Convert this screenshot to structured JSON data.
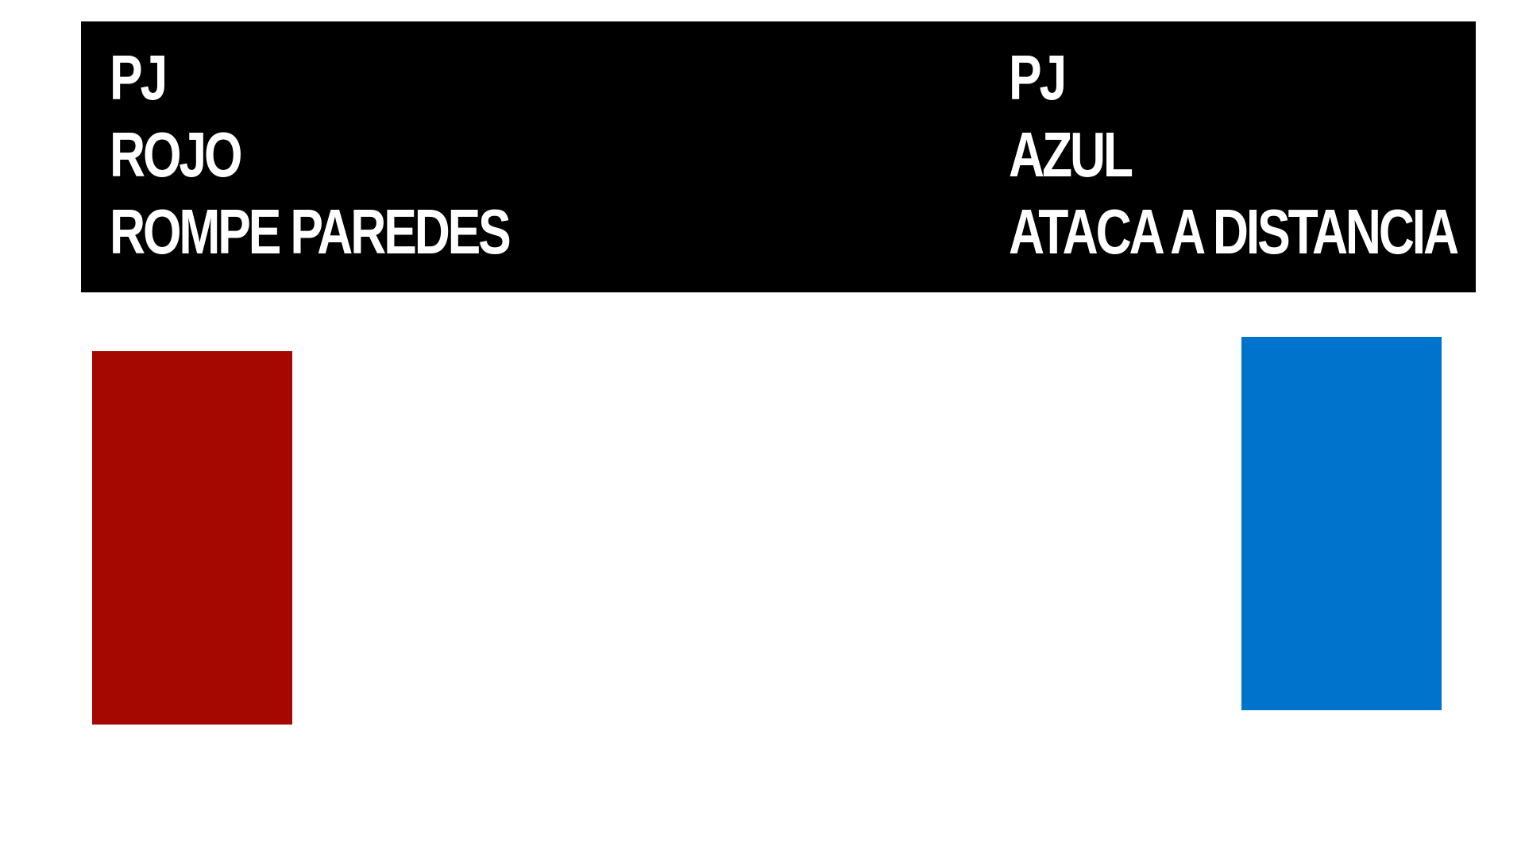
{
  "characters": [
    {
      "type": "PJ",
      "color_name": "ROJO",
      "ability": "ROMPE PAREDES",
      "color": "#a50800"
    },
    {
      "type": "PJ",
      "color_name": "AZUL",
      "ability": "ATACA A DISTANCIA",
      "color": "#0074cc"
    }
  ]
}
